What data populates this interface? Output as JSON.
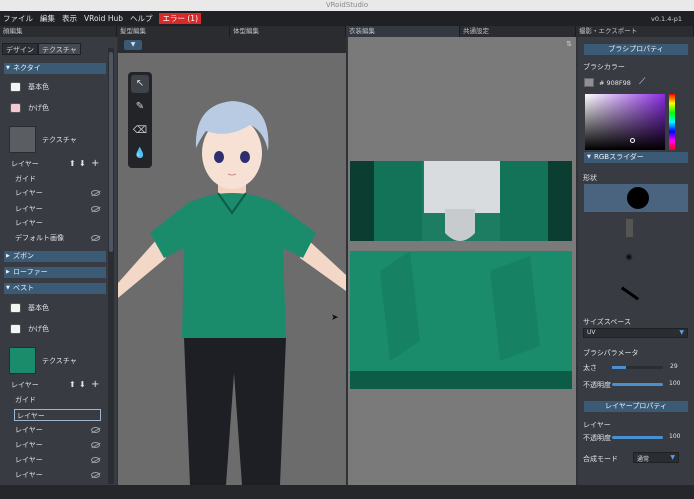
{
  "app": {
    "title": "VRoidStudio",
    "version": "v0.1.4-p1"
  },
  "menu": [
    "ファイル",
    "編集",
    "表示",
    "VRoid Hub",
    "ヘルプ"
  ],
  "error_badge": "エラー (1)",
  "top_tabs": [
    "顔編集",
    "髪型編集",
    "体型編集",
    "衣装編集",
    "共通設定",
    "撮影・エクスポート"
  ],
  "left": {
    "subtabs": [
      "デザイン",
      "テクスチャ"
    ],
    "sections": {
      "necktie": "ネクタイ",
      "pants": "ズボン",
      "loafer": "ローファー",
      "vest": "ベスト"
    },
    "base_color": "基本色",
    "shadow_color": "かげ色",
    "texture": "テクスチャ",
    "layer_header": "レイヤー",
    "layers_necktie": [
      "ガイド",
      "レイヤー",
      "レイヤー",
      "レイヤー",
      "デフォルト画像"
    ],
    "layers_vest": [
      "ガイド",
      "レイヤー",
      "レイヤー",
      "レイヤー",
      "レイヤー",
      "レイヤー"
    ]
  },
  "right": {
    "brush_props": "ブラシプロパティ",
    "brush_color": "ブラシカラー",
    "hex": "# 908F98",
    "rgb_slider": "RGBスライダー",
    "shape": "形状",
    "size_space": "サイズスペース",
    "size_space_value": "UV",
    "brush_params": "ブラシパラメータ",
    "thickness": "太さ",
    "thickness_value": "29",
    "opacity": "不透明度",
    "opacity_value": "100",
    "layer_props": "レイヤープロパティ",
    "layer": "レイヤー",
    "layer_opacity": "不透明度",
    "layer_opacity_value": "100",
    "blend_mode": "合成モード",
    "blend_mode_value": "通常"
  },
  "colors": {
    "accent": "#3b5a75",
    "shirt": "#1a8c6c",
    "error": "#d92a2a"
  }
}
